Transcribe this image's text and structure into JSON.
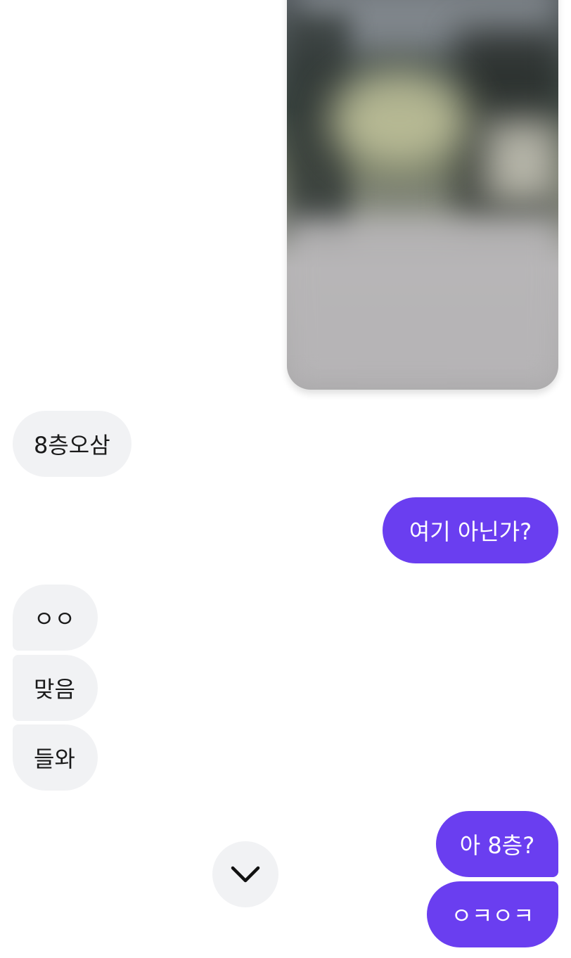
{
  "photo": {
    "icon": "blurred-photo",
    "colors": [
      "#5b6066",
      "#3e4a45",
      "#b4b3b3"
    ]
  },
  "messages": [
    {
      "side": "received",
      "text": "8층오삼"
    },
    {
      "side": "sent",
      "text": "여기 아닌가?"
    },
    {
      "side": "received",
      "text": "ㅇㅇ"
    },
    {
      "side": "received",
      "text": "맞음"
    },
    {
      "side": "received",
      "text": "들와"
    },
    {
      "side": "sent",
      "text": "아 8층?"
    },
    {
      "side": "sent",
      "text": "ㅇㅋㅇㅋ"
    }
  ],
  "scroll_button": {
    "icon": "chevron-down-icon"
  },
  "colors": {
    "sent_bubble": "#6a3ef0",
    "received_bubble": "#f1f2f4",
    "background": "#ffffff"
  }
}
